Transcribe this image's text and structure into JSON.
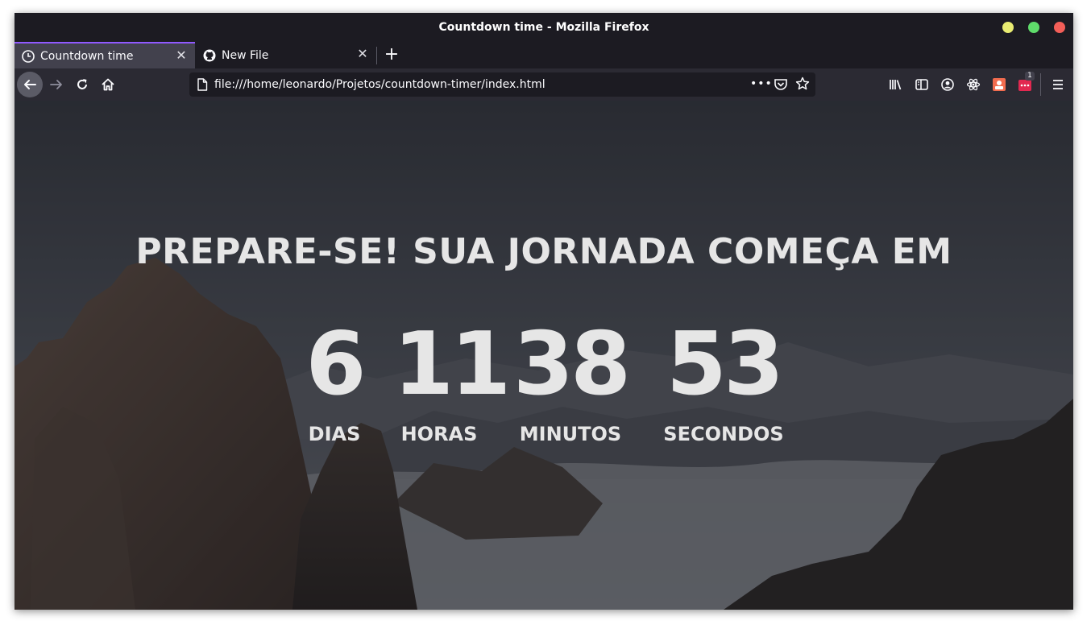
{
  "window": {
    "title": "Countdown time - Mozilla Firefox",
    "controls_colors": {
      "minimize": "#e9ec72",
      "maximize": "#5fdc6b",
      "close": "#f35e58"
    }
  },
  "tabs": [
    {
      "label": "Countdown time",
      "active": true,
      "icon": "timer-icon"
    },
    {
      "label": "New File",
      "active": false,
      "icon": "github-icon"
    }
  ],
  "toolbar": {
    "url": "file:///home/leonardo/Projetos/countdown-timer/index.html",
    "badge_count": "1",
    "accent": "#9059ff"
  },
  "page": {
    "headline": "PREPARE-SE! SUA JORNADA COMEÇA EM",
    "countdown": [
      {
        "value": "6",
        "label": "DIAS"
      },
      {
        "value": "11",
        "label": "HORAS"
      },
      {
        "value": "38",
        "label": "MINUTOS"
      },
      {
        "value": "53",
        "label": "SECONDOS"
      }
    ]
  }
}
